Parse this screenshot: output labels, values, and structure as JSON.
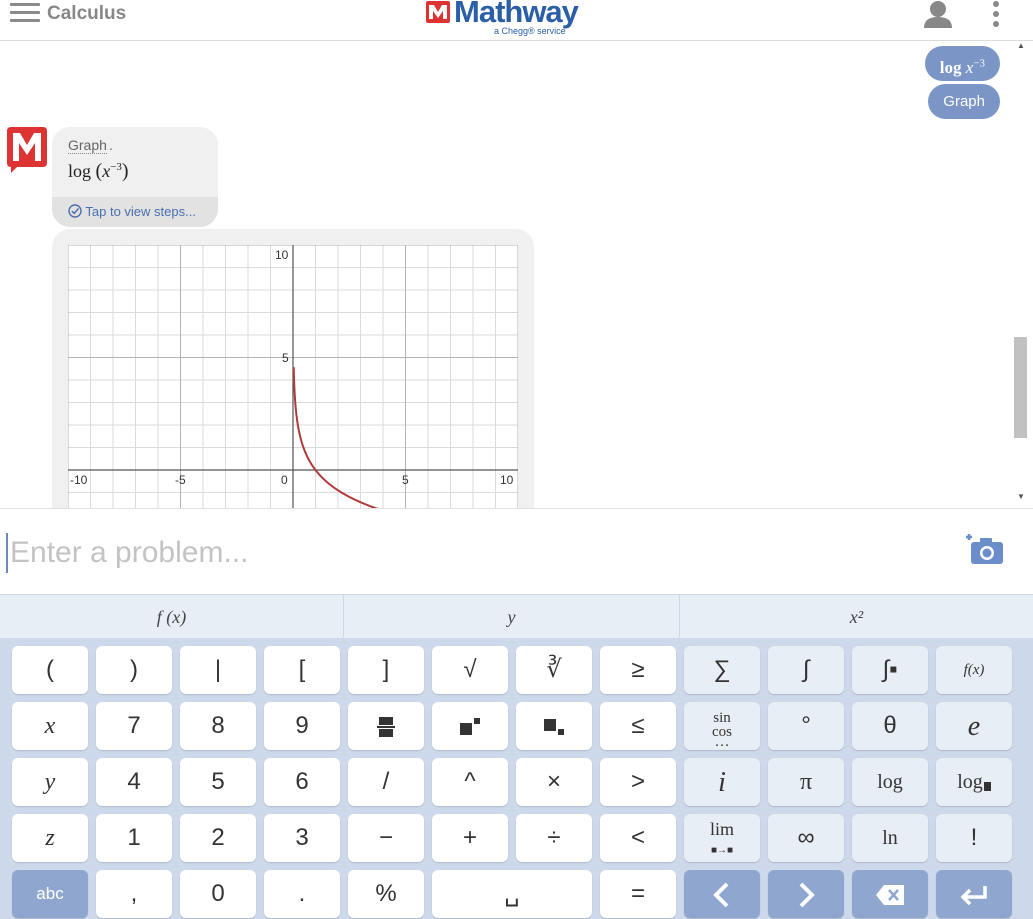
{
  "header": {
    "title": "Calculus",
    "logo_text": "Mathway",
    "logo_sub": "a Chegg® service"
  },
  "chat": {
    "user_messages": [
      "log x^{-3}",
      "Graph"
    ],
    "bot": {
      "label": "Graph",
      "period": ".",
      "expression": "log (x^{-3})",
      "steps_link": "Tap to view steps..."
    },
    "graph": {
      "x_ticks": [
        "-10",
        "-5",
        "0",
        "5",
        "10"
      ],
      "y_ticks": [
        "10",
        "5"
      ],
      "function": "log(x^-3)"
    }
  },
  "input": {
    "placeholder": "Enter a problem..."
  },
  "keyboard_tabs": [
    "f (x)",
    "y",
    "x²"
  ],
  "keyboard": {
    "rows": [
      [
        "(",
        ")",
        "|",
        "[",
        "]",
        "√",
        "∛",
        "≥",
        "∑",
        "∫",
        "∫̲",
        "f(x)"
      ],
      [
        "x",
        "7",
        "8",
        "9",
        "▀▄",
        "■▪",
        "■.",
        "≤",
        "sin cos",
        "°",
        "θ",
        "e"
      ],
      [
        "y",
        "4",
        "5",
        "6",
        "/",
        "^",
        "×",
        ">",
        "i",
        "π",
        "log",
        "log▪"
      ],
      [
        "z",
        "1",
        "2",
        "3",
        "−",
        "+",
        "÷",
        "<",
        "lim",
        "∞",
        "ln",
        "!"
      ],
      [
        "abc",
        ",",
        "0",
        ".",
        "%",
        "␣",
        "=",
        "<",
        ">",
        "⌫",
        "↵"
      ]
    ]
  },
  "colors": {
    "accent": "#7b95c7",
    "curve": "#b03a3a",
    "keyboard_bg": "#cdd8ea"
  }
}
